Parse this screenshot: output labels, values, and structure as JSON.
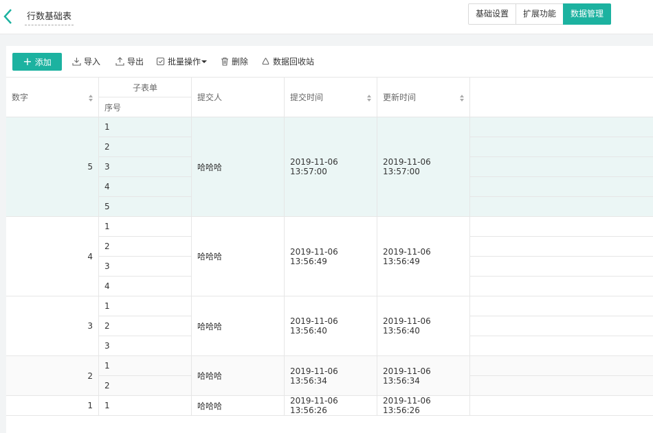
{
  "header": {
    "form_title": "行数基础表",
    "tabs": [
      "基础设置",
      "扩展功能",
      "数据管理"
    ],
    "active_tab": "数据管理",
    "accent": "#1cb2a0"
  },
  "toolbar": {
    "add_label": "添加",
    "import_label": "导入",
    "export_label": "导出",
    "batch_label": "批量操作",
    "delete_label": "删除",
    "recycle_label": "数据回收站"
  },
  "table": {
    "columns": {
      "number": "数字",
      "subform": "子表单",
      "seq": "序号",
      "submitter": "提交人",
      "submit_time": "提交时间",
      "update_time": "更新时间"
    },
    "rows": [
      {
        "number": "5",
        "seq": [
          "1",
          "2",
          "3",
          "4",
          "5"
        ],
        "submitter": "哈哈哈",
        "submit_time": "2019-11-06 13:57:00",
        "update_time": "2019-11-06 13:57:00",
        "highlighted": true
      },
      {
        "number": "4",
        "seq": [
          "1",
          "2",
          "3",
          "4"
        ],
        "submitter": "哈哈哈",
        "submit_time": "2019-11-06 13:56:49",
        "update_time": "2019-11-06 13:56:49",
        "highlighted": false
      },
      {
        "number": "3",
        "seq": [
          "1",
          "2",
          "3"
        ],
        "submitter": "哈哈哈",
        "submit_time": "2019-11-06 13:56:40",
        "update_time": "2019-11-06 13:56:40",
        "highlighted": false
      },
      {
        "number": "2",
        "seq": [
          "1",
          "2"
        ],
        "submitter": "哈哈哈",
        "submit_time": "2019-11-06 13:56:34",
        "update_time": "2019-11-06 13:56:34",
        "highlighted": false
      },
      {
        "number": "1",
        "seq": [
          "1"
        ],
        "submitter": "哈哈哈",
        "submit_time": "2019-11-06 13:56:26",
        "update_time": "2019-11-06 13:56:26",
        "highlighted": false
      }
    ],
    "highlight_color": "#ebf6f5",
    "alt_color": "#fafafa"
  }
}
